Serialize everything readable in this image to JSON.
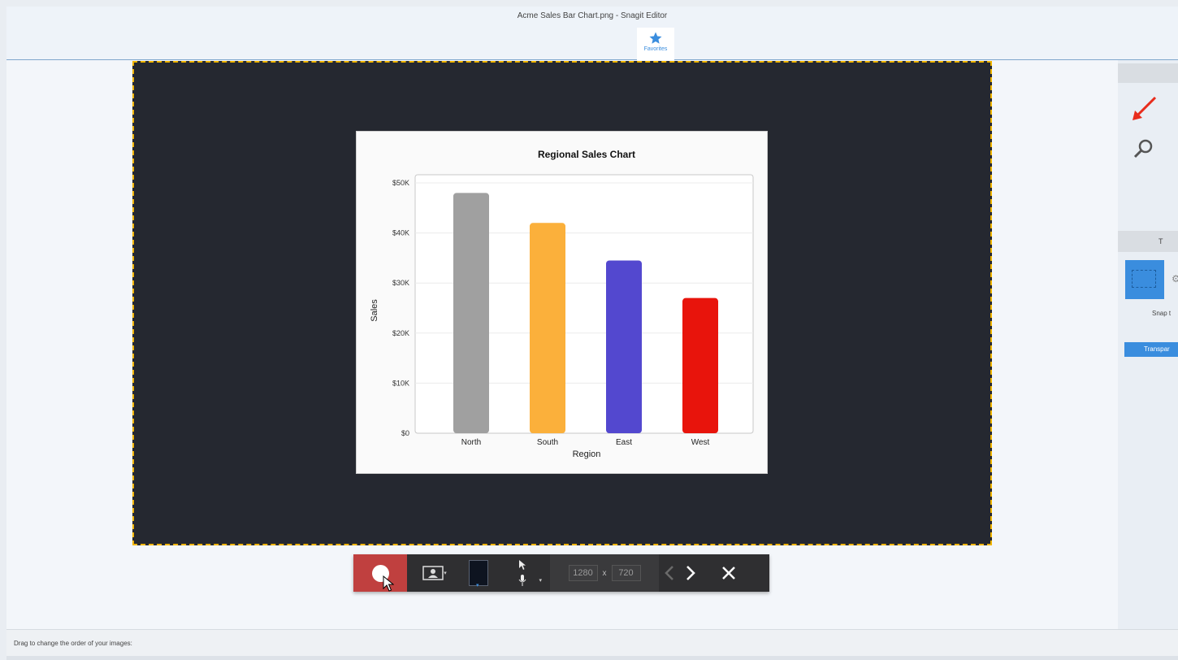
{
  "window": {
    "title": "Acme Sales Bar Chart.png - Snagit Editor"
  },
  "ribbon": {
    "favorites_label": "Favorites"
  },
  "recording_toolbar": {
    "width_value": "1280",
    "height_value": "720",
    "dimension_separator": "x"
  },
  "right_panel": {
    "section_label": "T",
    "snap_label": "Snap t",
    "transparent_label": "Transpar"
  },
  "tray": {
    "hint": "Drag to change the order of your images:"
  },
  "colors": {
    "accent": "#3a8dde",
    "record_red": "#c0403f",
    "frame_dashed": "#f0b400",
    "canvas_dark": "#252830"
  },
  "chart_data": {
    "type": "bar",
    "title": "Regional Sales Chart",
    "xlabel": "Region",
    "ylabel": "Sales",
    "categories": [
      "North",
      "South",
      "East",
      "West"
    ],
    "values": [
      48000,
      42000,
      34500,
      27000
    ],
    "colors": [
      "#a0a0a0",
      "#fbb03b",
      "#5348cf",
      "#e8140c"
    ],
    "ylim": [
      0,
      50000
    ],
    "yticks": [
      {
        "value": 0,
        "label": "$0"
      },
      {
        "value": 10000,
        "label": "$10K"
      },
      {
        "value": 20000,
        "label": "$20K"
      },
      {
        "value": 30000,
        "label": "$30K"
      },
      {
        "value": 40000,
        "label": "$40K"
      },
      {
        "value": 50000,
        "label": "$50K"
      }
    ],
    "grid": true
  }
}
